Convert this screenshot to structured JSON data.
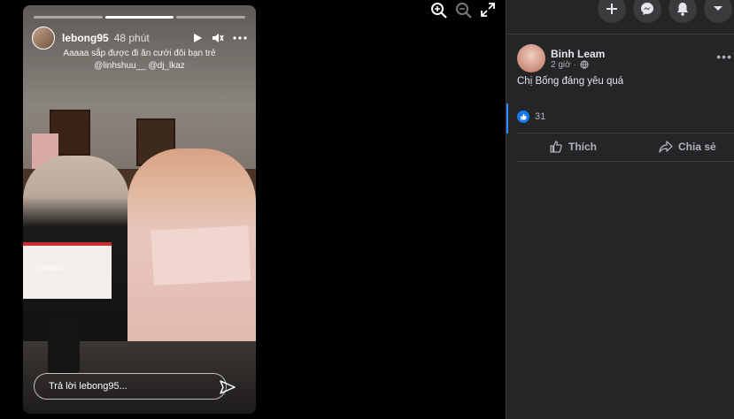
{
  "story": {
    "username": "lebong95",
    "time": "48 phút",
    "caption_line1": "Aaaaa sắp được đi ăn cưới đôi bạn trẻ",
    "caption_line2": "@linhshuu__  @dj_lkaz",
    "tag_overlay": "@anbon_",
    "reply_placeholder": "Trả lời lebong95...",
    "progress_segments": 3,
    "progress_done": 1
  },
  "post": {
    "author": "Binh Leam",
    "time": "2 giờ ·",
    "text": "Chị Bống đáng yêu quá",
    "reaction_count": "31",
    "like_label": "Thích",
    "share_label": "Chia sẻ"
  },
  "colors": {
    "panel_bg": "#242526",
    "accent": "#1877f2"
  }
}
